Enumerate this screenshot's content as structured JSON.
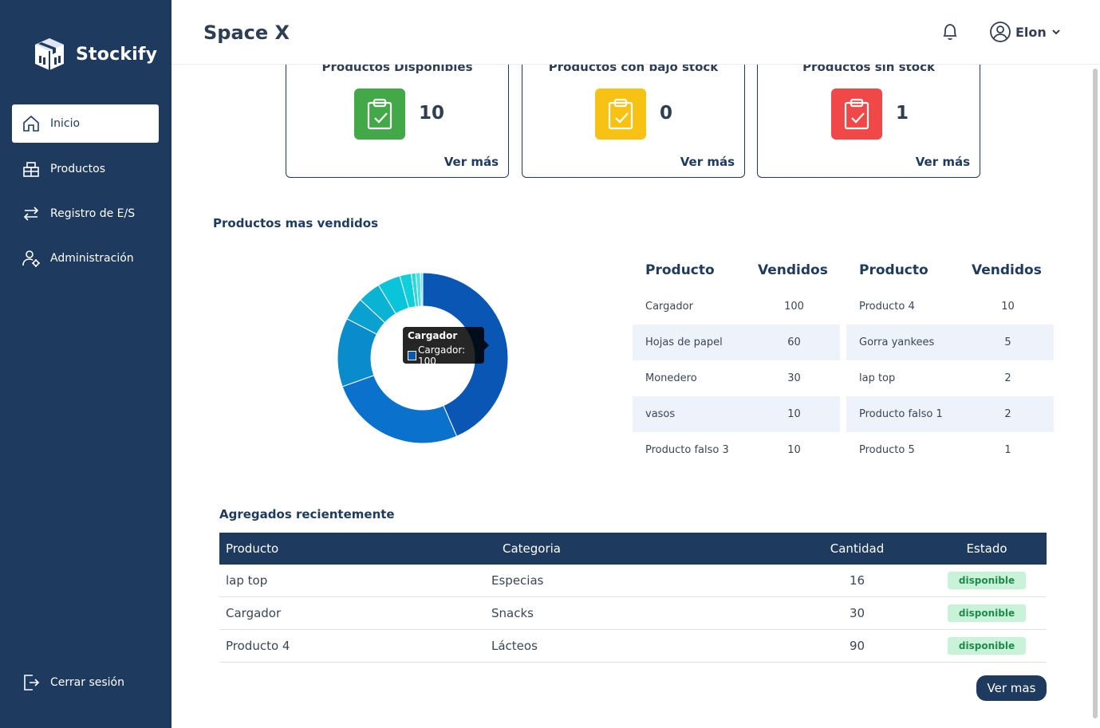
{
  "sidebar": {
    "brand": "Stockify",
    "items": [
      {
        "label": "Inicio",
        "icon": "home-icon"
      },
      {
        "label": "Productos",
        "icon": "box-icon"
      },
      {
        "label": "Registro de E/S",
        "icon": "transfer-icon"
      },
      {
        "label": "Administración",
        "icon": "user-gear-icon"
      }
    ],
    "logout": {
      "label": "Cerrar sesión",
      "icon": "logout-icon"
    }
  },
  "header": {
    "company": "Space X",
    "user": "Elon"
  },
  "cards": [
    {
      "title": "Productos Disponibles",
      "value": "10",
      "link": "Ver más",
      "color": "#43a847"
    },
    {
      "title": "Productos con bajo stock",
      "value": "0",
      "link": "Ver más",
      "color": "#f7c214"
    },
    {
      "title": "Productos sin stock",
      "value": "1",
      "link": "Ver más",
      "color": "#f04848"
    }
  ],
  "top_sold": {
    "title": "Productos mas vendidos",
    "col_product": "Producto",
    "col_sold": "Vendidos",
    "left": [
      {
        "product": "Cargador",
        "sold": "100"
      },
      {
        "product": "Hojas de papel",
        "sold": "60"
      },
      {
        "product": "Monedero",
        "sold": "30"
      },
      {
        "product": "vasos",
        "sold": "10"
      },
      {
        "product": "Producto falso 3",
        "sold": "10"
      }
    ],
    "right": [
      {
        "product": "Producto 4",
        "sold": "10"
      },
      {
        "product": "Gorra yankees",
        "sold": "5"
      },
      {
        "product": "lap top",
        "sold": "2"
      },
      {
        "product": "Producto falso 1",
        "sold": "2"
      },
      {
        "product": "Producto 5",
        "sold": "1"
      }
    ]
  },
  "chart_data": {
    "type": "pie",
    "title": "",
    "categories": [
      "Cargador",
      "Hojas de papel",
      "Monedero",
      "vasos",
      "Producto falso 3",
      "Producto 4",
      "Gorra yankees",
      "lap top",
      "Producto falso 1",
      "Producto 5"
    ],
    "values": [
      100,
      60,
      30,
      10,
      10,
      10,
      5,
      2,
      2,
      1
    ],
    "colors": [
      "#0a56b5",
      "#0a72cc",
      "#0a8bcc",
      "#0aa0cf",
      "#0ab3d4",
      "#0ac4d9",
      "#0fcfda",
      "#2dd8dc",
      "#4fe0df",
      "#6ee6e3"
    ],
    "tooltip": {
      "title": "Cargador",
      "label": "Cargador: 100"
    }
  },
  "recent": {
    "title": "Agregados recientemente",
    "headers": [
      "Producto",
      "Categoria",
      "Cantidad",
      "Estado"
    ],
    "rows": [
      {
        "product": "lap top",
        "category": "Especias",
        "qty": "16",
        "status": "disponible"
      },
      {
        "product": "Cargador",
        "category": "Snacks",
        "qty": "30",
        "status": "disponible"
      },
      {
        "product": "Producto 4",
        "category": "Lácteos",
        "qty": "90",
        "status": "disponible"
      }
    ],
    "button": "Ver mas"
  }
}
